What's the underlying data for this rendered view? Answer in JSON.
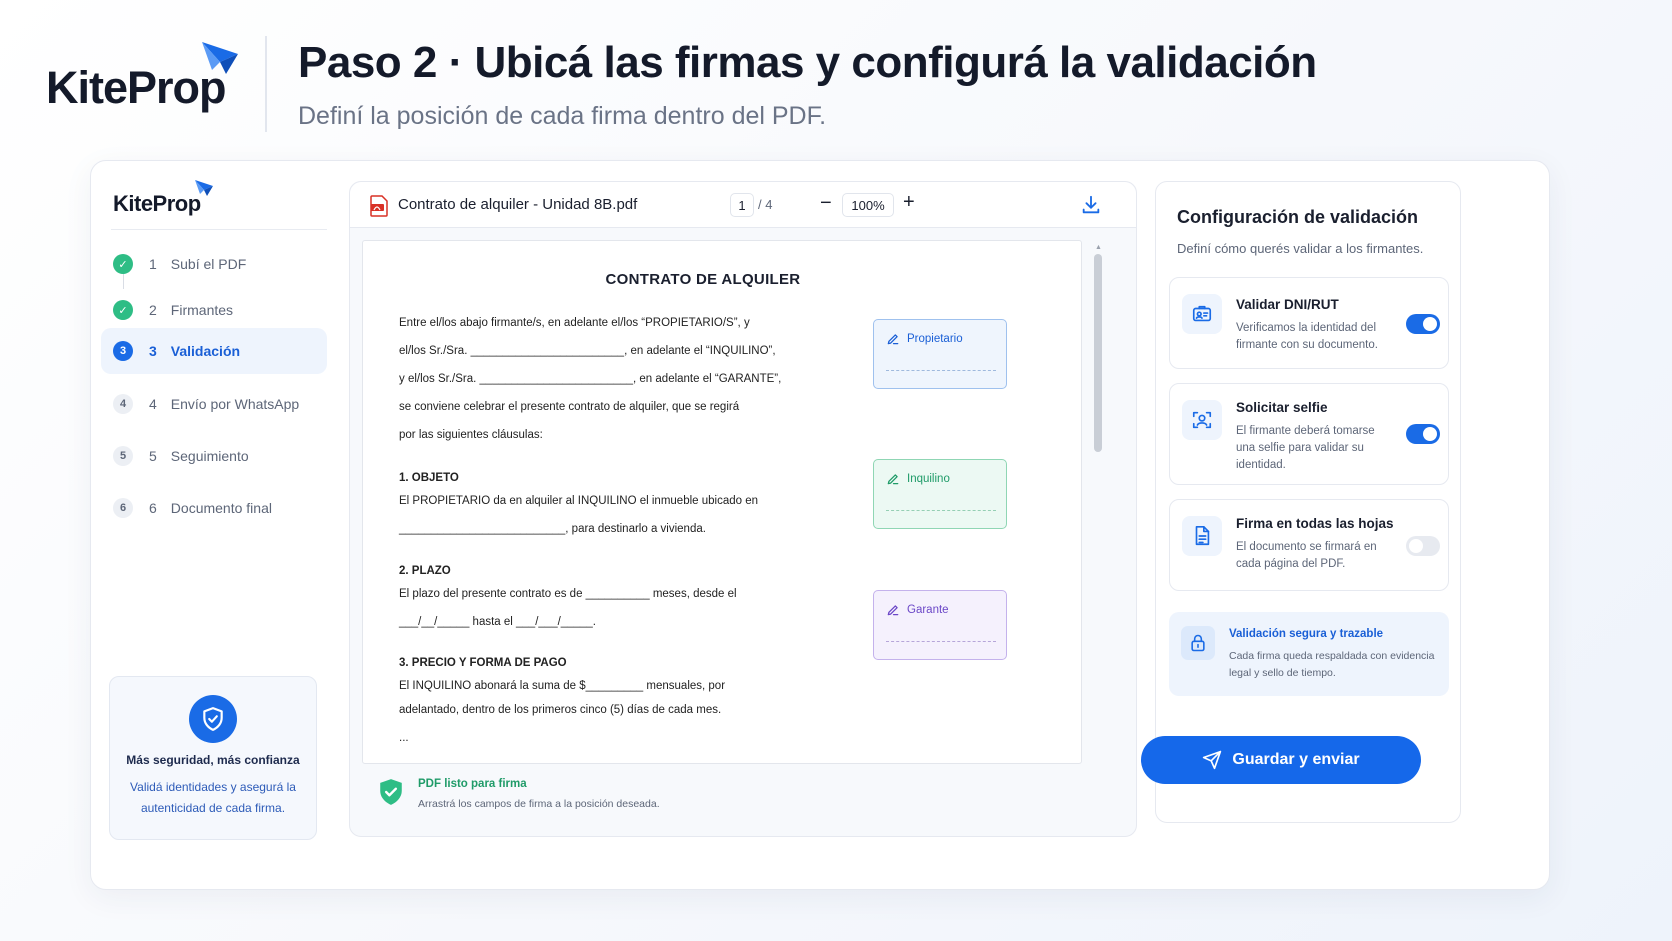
{
  "brand": {
    "name": "KiteProp",
    "accent": "#1a6be6",
    "success": "#2ebd85"
  },
  "header": {
    "title": "Paso 2 · Ubicá las firmas y configurá la validación",
    "subtitle": "Definí la posición de cada firma dentro del PDF."
  },
  "sidebar": {
    "steps": [
      {
        "badge": "✓",
        "num": "1",
        "label": "Subí el PDF",
        "state": "done"
      },
      {
        "badge": "✓",
        "num": "2",
        "label": "Firmantes",
        "state": "done"
      },
      {
        "badge": "3",
        "num": "3",
        "label": "Validación",
        "state": "active"
      },
      {
        "badge": "4",
        "num": "4",
        "label": "Envío por WhatsApp",
        "state": "todo"
      },
      {
        "badge": "5",
        "num": "5",
        "label": "Seguimiento",
        "state": "todo"
      },
      {
        "badge": "6",
        "num": "6",
        "label": "Documento final",
        "state": "todo"
      }
    ],
    "trust": {
      "title": "Más seguridad, más confianza",
      "text": "Validá identidades y asegurá la autenticidad de cada firma."
    }
  },
  "viewer": {
    "filename": "Contrato de alquiler - Unidad 8B.pdf",
    "page_current": "1",
    "page_total": "/ 4",
    "zoom": "100%",
    "zoom_minus": "−",
    "zoom_plus": "+",
    "document": {
      "title": "CONTRATO DE ALQUILER",
      "intro": [
        "Entre el/los abajo firmante/s, en adelante el/los “PROPIETARIO/S”, y",
        "el/los Sr./Sra. ________________________, en adelante el “INQUILINO”,",
        "y el/los Sr./Sra. ________________________, en adelante el “GARANTE”,",
        "se conviene celebrar el presente contrato de alquiler, que se regirá",
        "por las siguientes cláusulas:"
      ],
      "s1_title": "1. OBJETO",
      "s1": [
        "El PROPIETARIO da en alquiler al INQUILINO el inmueble ubicado en",
        "__________________________, para destinarlo a vivienda."
      ],
      "s2_title": "2. PLAZO",
      "s2": [
        "El plazo del presente contrato es de __________ meses, desde el",
        "___/__/_____ hasta el ___/___/_____."
      ],
      "s3_title": "3. PRECIO Y FORMA DE PAGO",
      "s3": [
        "El INQUILINO abonará la suma de $_________ mensuales, por",
        "adelantado, dentro de los primeros cinco (5) días de cada mes."
      ],
      "ellipsis": "..."
    },
    "signature_fields": {
      "propietario": "Propietario",
      "inquilino": "Inquilino",
      "garante": "Garante"
    },
    "ready": {
      "title": "PDF listo para firma",
      "text": "Arrastrá los campos de firma a la posición deseada."
    }
  },
  "config": {
    "title": "Configuración de validación",
    "subtitle": "Definí cómo querés validar a los firmantes.",
    "options": [
      {
        "title": "Validar DNI/RUT",
        "desc": "Verificamos la identidad del firmante con su documento.",
        "enabled": true,
        "icon": "id-card-icon"
      },
      {
        "title": "Solicitar selfie",
        "desc": "El firmante deberá tomarse una selfie para validar su identidad.",
        "enabled": true,
        "icon": "face-scan-icon"
      },
      {
        "title": "Firma en todas las hojas",
        "desc": "El documento se firmará en cada página del PDF.",
        "enabled": false,
        "icon": "document-icon"
      }
    ],
    "secure": {
      "title": "Validación segura y trazable",
      "text": "Cada firma queda respaldada con evidencia legal y sello de tiempo."
    },
    "save_label": "Guardar y enviar"
  }
}
